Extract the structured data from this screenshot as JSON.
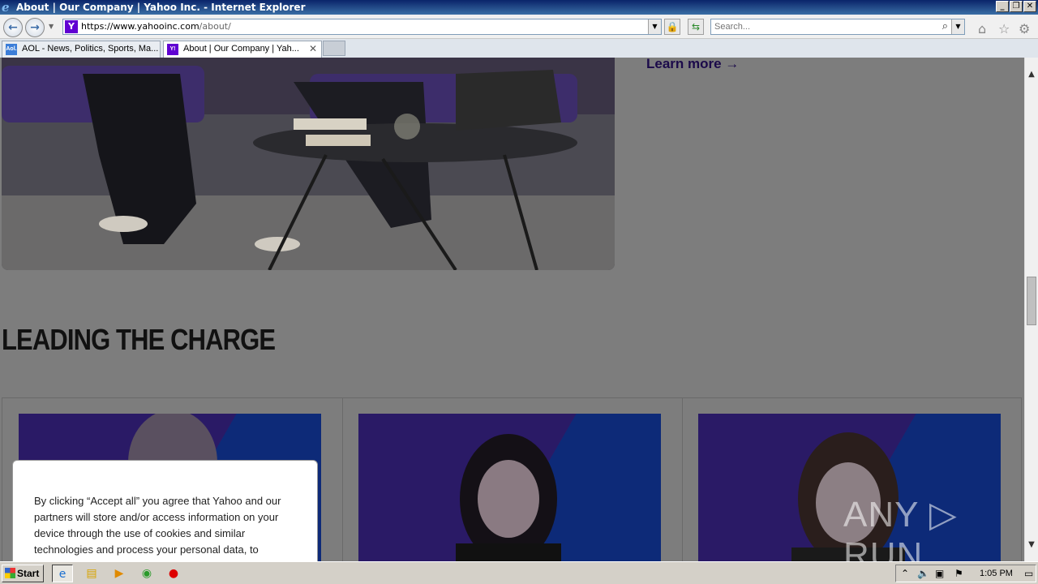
{
  "window": {
    "title": "About | Our Company | Yahoo Inc. - Internet Explorer",
    "controls": [
      "_",
      "❐",
      "✕"
    ]
  },
  "nav": {
    "url_host": "https://www.yahooinc.com",
    "url_path": "/about/",
    "search_placeholder": "Search..."
  },
  "tabs": [
    {
      "label": "AOL - News, Politics, Sports, Ma...",
      "favicon": "Aol."
    },
    {
      "label": "About | Our Company | Yah...",
      "favicon": "Y!",
      "close": "✕"
    }
  ],
  "page": {
    "learn_more": "Learn more →",
    "heading": "LEADING THE CHARGE",
    "cookie_text": "By clicking “Accept all” you agree that Yahoo and our partners will store and/or access information on your device through the use of cookies and similar technologies and process your personal data, to"
  },
  "watermark": "ANY ▷ RUN",
  "taskbar": {
    "start_label": "Start",
    "clock": "1:05 PM"
  },
  "colors": {
    "learn_more": "#1b0a4a",
    "portrait_purple": "#2a1a66",
    "portrait_blue": "#0d2a78"
  }
}
